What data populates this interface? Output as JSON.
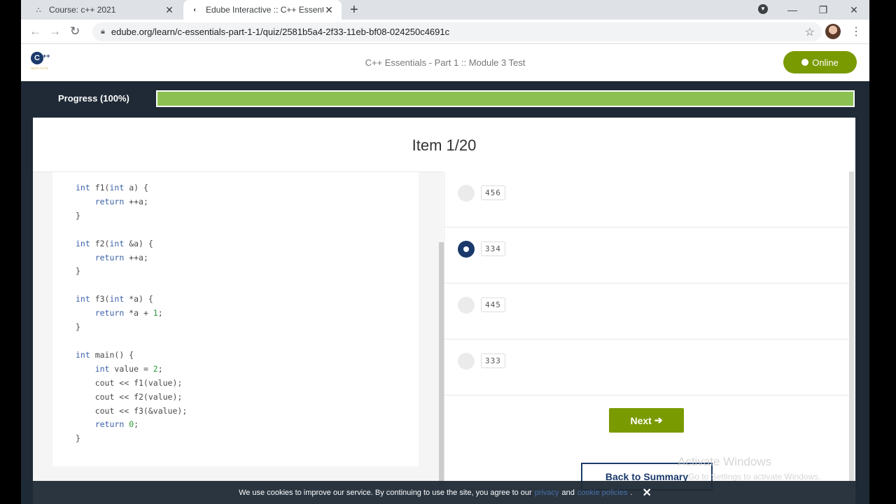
{
  "browser": {
    "tabs": [
      {
        "title": "Course: c++ 2021",
        "close": "✕"
      },
      {
        "title": "Edube Interactive :: C++ Essentia",
        "close": "✕"
      }
    ],
    "new_tab": "+",
    "url": "edube.org/learn/c-essentials-part-1-1/quiz/2581b5a4-2f33-11eb-bf08-024250c4691c",
    "window_controls": [
      "—",
      "❐",
      "✕"
    ]
  },
  "header": {
    "logo_text": "C",
    "logo_plus": "++",
    "logo_sub": "INSTITUTE",
    "course_title": "C++ Essentials - Part 1 :: Module 3 Test",
    "status_label": "Online"
  },
  "progress": {
    "label": "Progress (100%)",
    "value": 1.0,
    "fill_color": "#8cc152"
  },
  "quiz": {
    "item_title": "Item 1/20",
    "code_lines": [
      [
        "kw:int",
        " f1(",
        "kw:int",
        " a) {"
      ],
      [
        "    ",
        "kw:return",
        " ++a;"
      ],
      [
        "}"
      ],
      [
        ""
      ],
      [
        "kw:int",
        " f2(",
        "kw:int",
        " &a) {"
      ],
      [
        "    ",
        "kw:return",
        " ++a;"
      ],
      [
        "}"
      ],
      [
        ""
      ],
      [
        "kw:int",
        " f3(",
        "kw:int",
        " *a) {"
      ],
      [
        "    ",
        "kw:return",
        " *a + ",
        "num:1",
        ";"
      ],
      [
        "}"
      ],
      [
        ""
      ],
      [
        "kw:int",
        " main() {"
      ],
      [
        "    ",
        "kw:int",
        " value = ",
        "num:2",
        ";"
      ],
      [
        "    cout << f1(value);"
      ],
      [
        "    cout << f2(value);"
      ],
      [
        "    cout << f3(&value);"
      ],
      [
        "    ",
        "kw:return",
        " ",
        "num:0",
        ";"
      ],
      [
        "}"
      ]
    ],
    "options": [
      {
        "label": "456",
        "selected": false
      },
      {
        "label": "334",
        "selected": true
      },
      {
        "label": "445",
        "selected": false
      },
      {
        "label": "333",
        "selected": false
      }
    ],
    "next_label": "Next",
    "next_arrow": "➔",
    "back_label": "Back to Summary"
  },
  "watermark": {
    "title": "Activate Windows",
    "subtitle": "Go to Settings to activate Windows."
  },
  "cookie": {
    "text_before": "We use cookies to improve our service. By continuing to use the site, you agree to our",
    "link1": "privacy",
    "text_mid": "and",
    "link2": "cookie policies",
    "text_after": ".",
    "close": "✕"
  },
  "colors": {
    "accent_green": "#7a9a01",
    "navy": "#1b3a6b",
    "dark_bg": "#1f2a36"
  }
}
